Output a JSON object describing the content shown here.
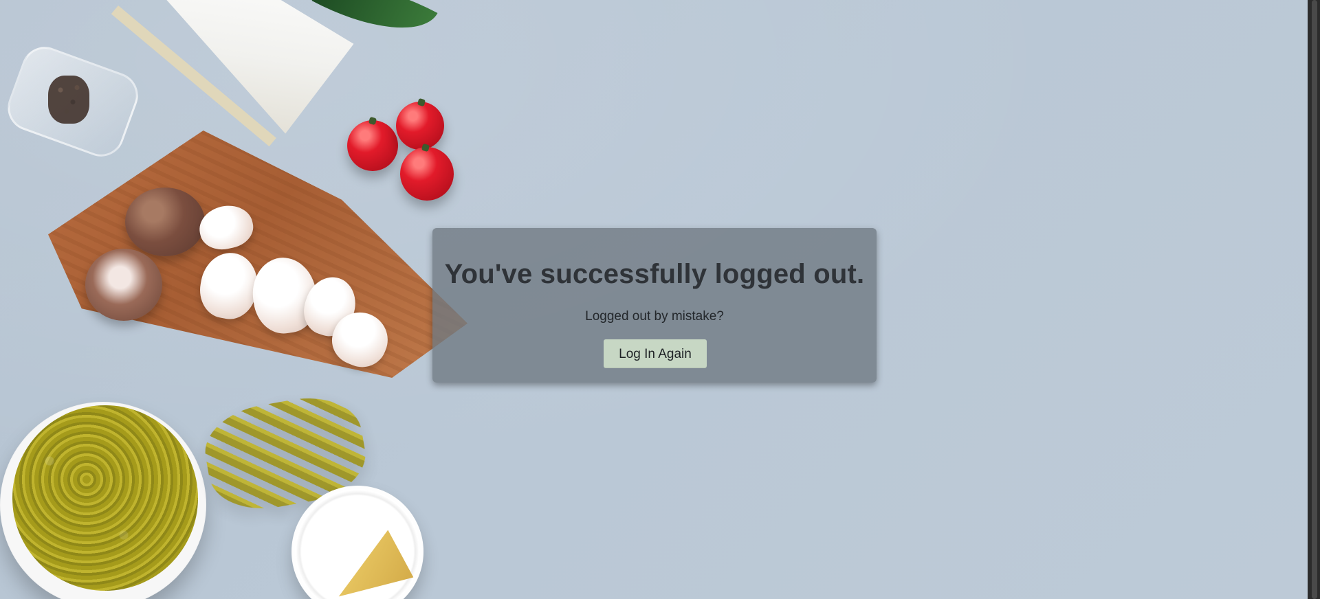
{
  "logout": {
    "title": "You've successfully logged out.",
    "subtitle": "Logged out by mistake?",
    "login_button_label": "Log In Again"
  },
  "colors": {
    "panel_bg": "#6E7882",
    "title_text": "#2F3338",
    "button_bg": "#C7D7C4",
    "page_bg": "#BAC8D6"
  }
}
